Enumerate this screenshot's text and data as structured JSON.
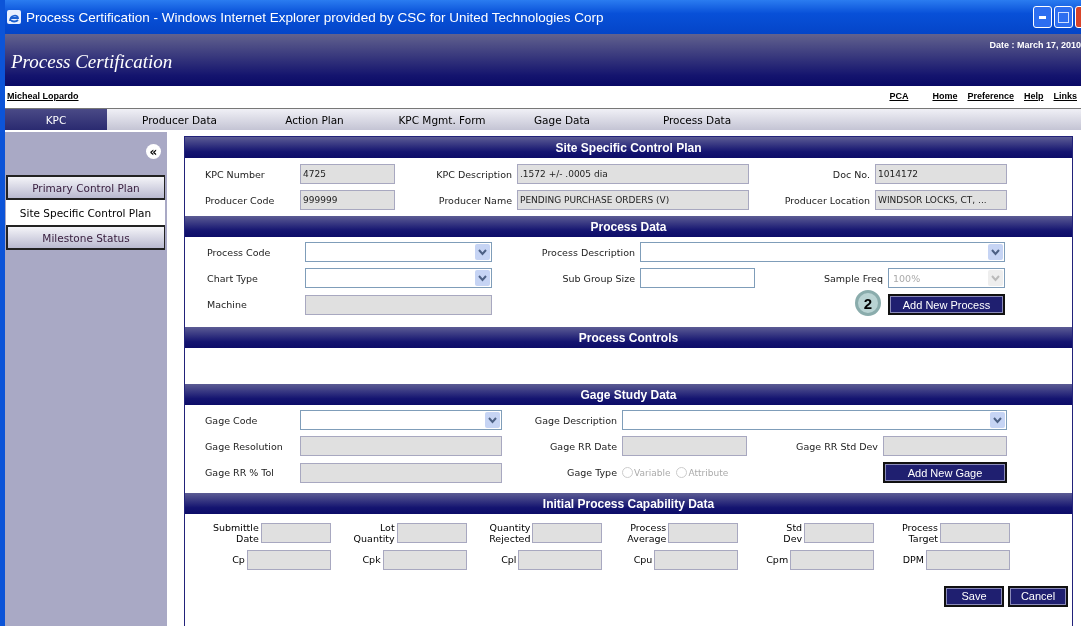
{
  "window": {
    "title": "Process Certification - Windows Internet Explorer provided by CSC for United Technologies Corp"
  },
  "header": {
    "app_title": "Process Certification",
    "date": "Date : March 17, 2010"
  },
  "user_link": "Micheal Lopardo",
  "nav_links": [
    "PCA",
    "Home",
    "Preference",
    "Help",
    "Links"
  ],
  "tabs": [
    {
      "label": "KPC",
      "selected": true
    },
    {
      "label": "Producer Data",
      "selected": false
    },
    {
      "label": "Action Plan",
      "selected": false
    },
    {
      "label": "KPC Mgmt. Form",
      "selected": false
    },
    {
      "label": "Gage Data",
      "selected": false
    },
    {
      "label": "Process Data",
      "selected": false
    }
  ],
  "sidebar": {
    "collapse": "«",
    "items": [
      {
        "label": "Primary Control Plan",
        "selected": false
      },
      {
        "label": "Site Specific Control Plan",
        "selected": true
      },
      {
        "label": "Milestone Status",
        "selected": false
      }
    ]
  },
  "site_plan": {
    "title": "Site Specific Control Plan",
    "fields": [
      {
        "label": "KPC Number",
        "value": "4725"
      },
      {
        "label": "KPC Description",
        "value": ".1572 +/- .0005 dia"
      },
      {
        "label": "Doc No.",
        "value": "1014172"
      },
      {
        "label": "Producer Code",
        "value": "999999"
      },
      {
        "label": "Producer Name",
        "value": "PENDING PURCHASE ORDERS (V)"
      },
      {
        "label": "Producer Location",
        "value": "WINDSOR LOCKS, CT, ..."
      }
    ]
  },
  "process_data": {
    "title": "Process Data",
    "rows": [
      [
        {
          "kind": "select",
          "label": "Process Code"
        },
        {
          "kind": "select",
          "label": "Process Description"
        }
      ],
      [
        {
          "kind": "select",
          "label": "Chart Type"
        },
        {
          "kind": "text",
          "label": "Sub Group Size"
        },
        {
          "kind": "select",
          "label": "Sample Freq",
          "value": "100%",
          "disabled": true
        }
      ],
      [
        {
          "kind": "readonly",
          "label": "Machine"
        },
        {
          "kind": "button",
          "label": "Add New Process",
          "badge": "2"
        }
      ]
    ]
  },
  "process_controls": {
    "title": "Process Controls"
  },
  "gage_study": {
    "title": "Gage Study Data",
    "rows": [
      [
        {
          "kind": "select",
          "label": "Gage Code"
        },
        {
          "kind": "select",
          "label": "Gage Description"
        }
      ],
      [
        {
          "kind": "readonly",
          "label": "Gage Resolution"
        },
        {
          "kind": "readonly",
          "label": "Gage RR Date"
        },
        {
          "kind": "readonly",
          "label": "Gage RR Std Dev"
        }
      ],
      [
        {
          "kind": "readonly",
          "label": "Gage RR % Tol"
        },
        {
          "kind": "radio",
          "label": "Gage Type",
          "disabled": true,
          "options": [
            {
              "label": "Variable",
              "selected": false
            },
            {
              "label": "Attribute",
              "selected": false
            }
          ]
        },
        {
          "kind": "button",
          "label": "Add New Gage"
        }
      ]
    ]
  },
  "capability": {
    "title": "Initial Process Capability Data",
    "rows": [
      [
        {
          "label": "Submittle\nDate"
        },
        {
          "label": "Lot\nQuantity"
        },
        {
          "label": "Quantity\nRejected"
        },
        {
          "label": "Process\nAverage"
        },
        {
          "label": "Std\nDev"
        },
        {
          "label": "Process\nTarget"
        }
      ],
      [
        {
          "label": "Cp"
        },
        {
          "label": "Cpk"
        },
        {
          "label": "Cpl"
        },
        {
          "label": "Cpu"
        },
        {
          "label": "Cpm"
        },
        {
          "label": "DPM"
        }
      ]
    ]
  },
  "actions": [
    "Save",
    "Cancel"
  ]
}
